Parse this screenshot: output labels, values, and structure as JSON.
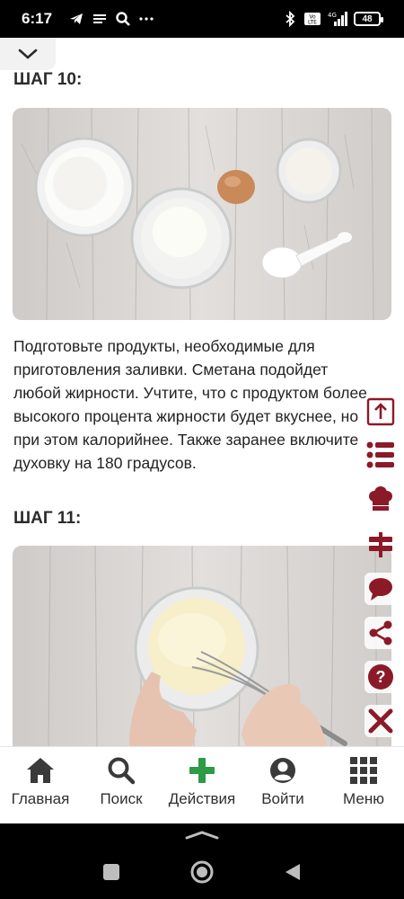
{
  "status_bar": {
    "time": "6:17",
    "battery": "48",
    "network": "4G",
    "volte": "Vo LTE"
  },
  "steps": [
    {
      "title": "ШАГ 10:",
      "description": "Подготовьте продукты, необходимые для приготовления заливки. Сметана подойдет любой жирности. Учтите, что с продуктом более высокого процента жирности будет вкуснее, но при этом калорийнее. Также заранее включите духовку на 180 градусов."
    },
    {
      "title": "ШАГ 11:"
    }
  ],
  "side_toolbar": {
    "icons": [
      "scroll-top-icon",
      "list-icon",
      "chef-hat-icon",
      "signpost-icon",
      "comment-icon",
      "share-icon",
      "help-icon",
      "close-icon"
    ],
    "color": "#8b1a28"
  },
  "bottom_nav": {
    "items": [
      {
        "label": "Главная",
        "icon": "home-icon"
      },
      {
        "label": "Поиск",
        "icon": "search-icon"
      },
      {
        "label": "Действия",
        "icon": "plus-icon"
      },
      {
        "label": "Войти",
        "icon": "user-icon"
      },
      {
        "label": "Меню",
        "icon": "grid-icon"
      }
    ],
    "accent": "#2e9b46"
  }
}
